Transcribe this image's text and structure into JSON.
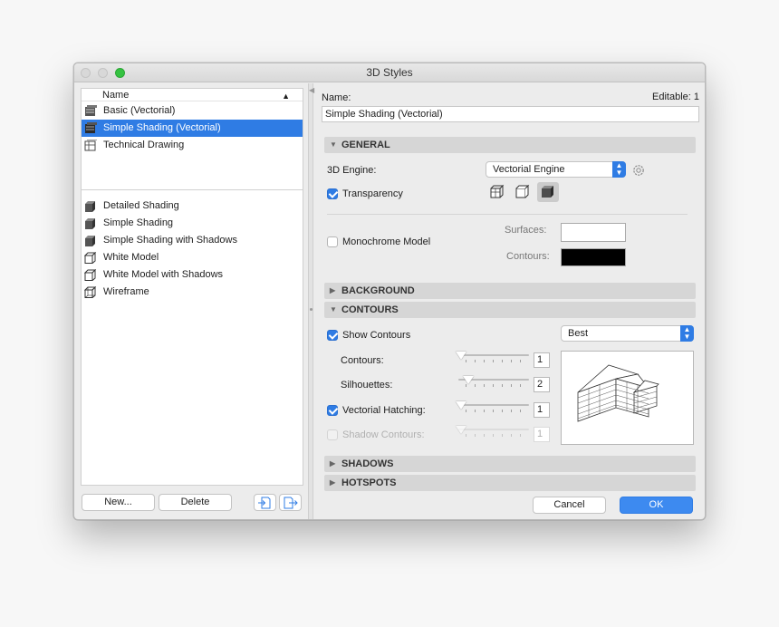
{
  "window": {
    "title": "3D Styles"
  },
  "list": {
    "header": "Name",
    "groups": [
      [
        {
          "label": "Basic (Vectorial)",
          "icon": "vectorial-style-icon",
          "selected": false
        },
        {
          "label": "Simple Shading (Vectorial)",
          "icon": "vectorial-style-icon",
          "selected": true
        },
        {
          "label": "Technical Drawing",
          "icon": "technical-drawing-icon",
          "selected": false
        }
      ],
      [
        {
          "label": "Detailed Shading",
          "icon": "shaded-box-icon"
        },
        {
          "label": "Simple Shading",
          "icon": "shaded-box-icon"
        },
        {
          "label": "Simple Shading with Shadows",
          "icon": "shaded-box-icon"
        },
        {
          "label": "White Model",
          "icon": "white-box-icon"
        },
        {
          "label": "White Model with Shadows",
          "icon": "white-box-icon"
        },
        {
          "label": "Wireframe",
          "icon": "wireframe-box-icon"
        }
      ]
    ],
    "new_label": "New...",
    "delete_label": "Delete"
  },
  "details": {
    "name_label": "Name:",
    "editable": "Editable: 1",
    "name_value": "Simple Shading (Vectorial)",
    "general": {
      "title": "GENERAL",
      "engine_label": "3D Engine:",
      "engine_value": "Vectorial Engine",
      "transparency_label": "Transparency",
      "transparency_checked": true,
      "monochrome_label": "Monochrome Model",
      "monochrome_checked": false,
      "surfaces_label": "Surfaces:",
      "surfaces_color": "#ffffff",
      "contours_label": "Contours:",
      "contours_color": "#000000"
    },
    "background": {
      "title": "BACKGROUND"
    },
    "contours": {
      "title": "CONTOURS",
      "show_label": "Show Contours",
      "show_checked": true,
      "quality_value": "Best",
      "rows": [
        {
          "label": "Contours:",
          "value": "1",
          "level": 0.0,
          "checkbox": false,
          "enabled": true
        },
        {
          "label": "Silhouettes:",
          "value": "2",
          "level": 0.1,
          "checkbox": false,
          "enabled": true
        },
        {
          "label": "Vectorial Hatching:",
          "value": "1",
          "level": 0.0,
          "checkbox": true,
          "checked": true,
          "enabled": true
        },
        {
          "label": "Shadow Contours:",
          "value": "1",
          "level": 0.0,
          "checkbox": true,
          "checked": false,
          "enabled": false
        }
      ]
    },
    "shadows": {
      "title": "SHADOWS"
    },
    "hotspots": {
      "title": "HOTSPOTS"
    },
    "cancel_label": "Cancel",
    "ok_label": "OK"
  },
  "colors": {
    "accent": "#2f7ce4",
    "selection_text": "#ffffff"
  }
}
